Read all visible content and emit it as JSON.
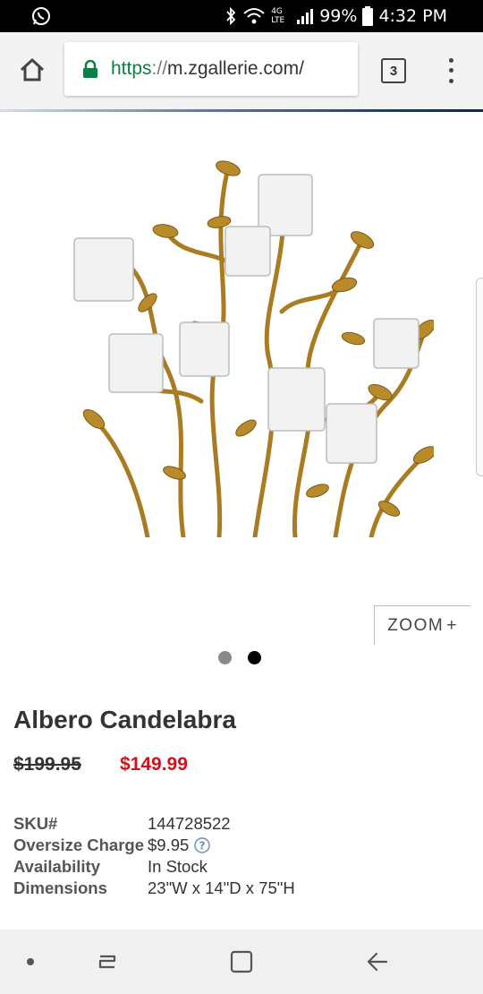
{
  "status_bar": {
    "battery": "99%",
    "time": "4:32 PM",
    "network": "4G LTE",
    "icons": [
      "whatsapp-icon",
      "bluetooth-icon",
      "wifi-icon",
      "signal-icon",
      "battery-icon"
    ]
  },
  "browser": {
    "url_scheme": "https",
    "url_separator": "://",
    "url_host": "m.zgallerie.com/",
    "tab_count": "3",
    "colors": {
      "secure": "#0b8043",
      "bar_bg": "#f3f3f3"
    }
  },
  "product": {
    "image_alt": "gold candelabra icon",
    "zoom_label": "ZOOM",
    "zoom_symbol": "+",
    "carousel": {
      "count": 2,
      "active_index": 1
    },
    "title": "Albero Candelabra",
    "original_price": "$199.95",
    "sale_price": "$149.99",
    "details": [
      {
        "label": "SKU#",
        "value": "144728522"
      },
      {
        "label": "Oversize Charge",
        "value": "$9.95"
      },
      {
        "label": "Availability",
        "value": "In Stock"
      },
      {
        "label": "Dimensions",
        "value": "23\"W x 14\"D x 75\"H"
      }
    ],
    "colors": {
      "sale": "#d0121b",
      "gold": "#b88a2a"
    }
  },
  "nav_bar": {
    "items": [
      "dot-icon",
      "recents-icon",
      "home-icon",
      "back-icon"
    ]
  }
}
